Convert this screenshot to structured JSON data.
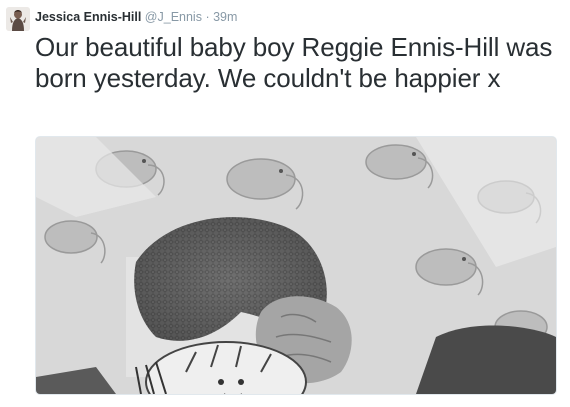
{
  "tweet": {
    "author_name": "Jessica Ennis-Hill",
    "author_handle": "@J_Ennis",
    "separator": "·",
    "time": "39m",
    "text": "Our beautiful baby boy Reggie Ennis-Hill was born yesterday. We couldn't be happier x",
    "avatar_icon": "profile-photo",
    "media_icon": "baby-hand-photo"
  },
  "colors": {
    "text": "#292f33",
    "meta": "#8899a6"
  }
}
